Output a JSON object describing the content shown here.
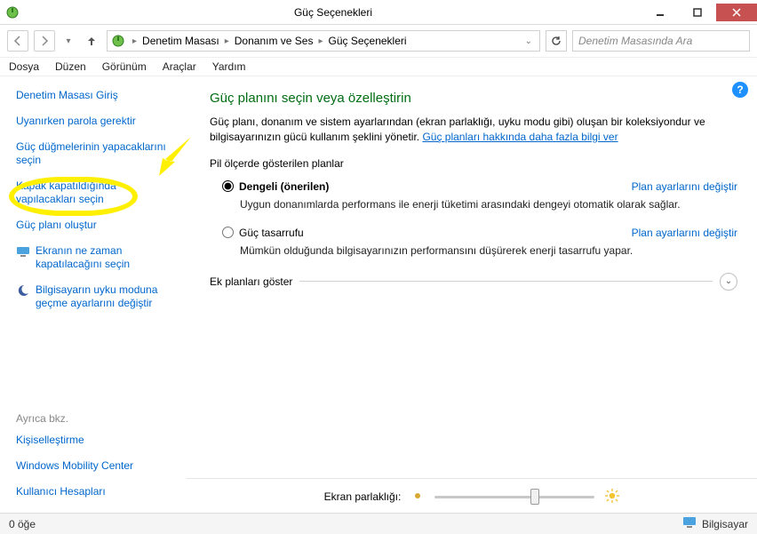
{
  "window": {
    "title": "Güç Seçenekleri"
  },
  "breadcrumb": {
    "items": [
      "Denetim Masası",
      "Donanım ve Ses",
      "Güç Seçenekleri"
    ]
  },
  "search": {
    "placeholder": "Denetim Masasında Ara"
  },
  "menus": [
    "Dosya",
    "Düzen",
    "Görünüm",
    "Araçlar",
    "Yardım"
  ],
  "sidebar": {
    "items": [
      "Denetim Masası Giriş",
      "Uyanırken parola gerektir",
      "Güç düğmelerinin yapacaklarını seçin",
      "Kapak kapatıldığında yapılacakları seçin",
      "Güç planı oluştur",
      "Ekranın ne zaman kapatılacağını seçin",
      "Bilgisayarın uyku moduna geçme ayarlarını değiştir"
    ],
    "seealso_header": "Ayrıca bkz.",
    "seealso": [
      "Kişiselleştirme",
      "Windows Mobility Center",
      "Kullanıcı Hesapları"
    ]
  },
  "main": {
    "heading": "Güç planını seçin veya özelleştirin",
    "description_prefix": "Güç planı, donanım ve sistem ayarlarından (ekran parlaklığı, uyku modu gibi) oluşan bir koleksiyondur ve bilgisayarınızın gücü kullanım şeklini yönetir. ",
    "description_link": "Güç planları hakkında daha fazla bilgi ver",
    "section_label": "Pil ölçerde gösterilen planlar",
    "plans": [
      {
        "name": "Dengeli (önerilen)",
        "desc": "Uygun donanımlarda performans ile enerji tüketimi arasındaki dengeyi otomatik olarak sağlar.",
        "link": "Plan ayarlarını değiştir",
        "checked": true
      },
      {
        "name": "Güç tasarrufu",
        "desc": "Mümkün olduğunda bilgisayarınızın performansını düşürerek enerji tasarrufu yapar.",
        "link": "Plan ayarlarını değiştir",
        "checked": false
      }
    ],
    "expand_label": "Ek planları göster",
    "brightness_label": "Ekran parlaklığı:"
  },
  "statusbar": {
    "left": "0 öğe",
    "right": "Bilgisayar"
  }
}
